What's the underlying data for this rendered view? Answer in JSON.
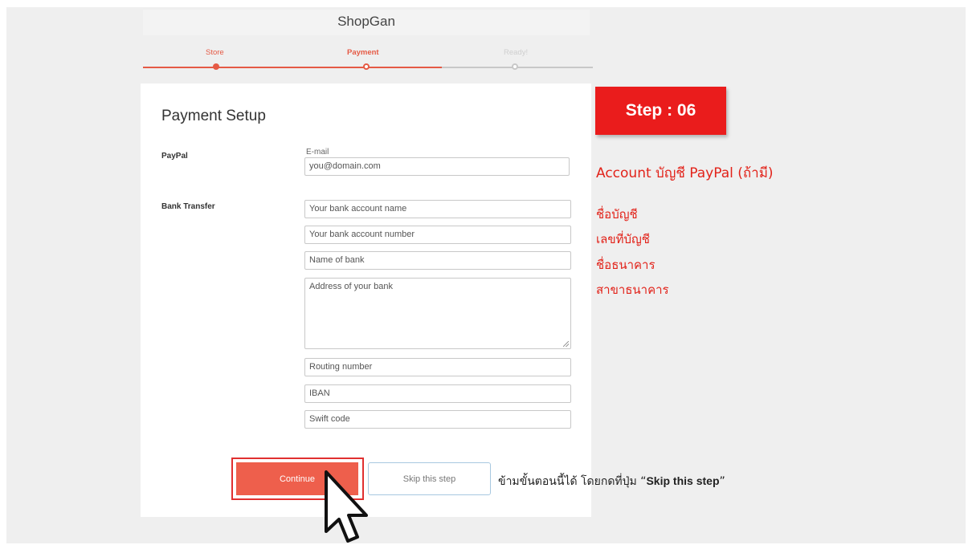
{
  "app": {
    "title": "ShopGan"
  },
  "steps": [
    {
      "label": "Store",
      "state": "done"
    },
    {
      "label": "Payment",
      "state": "active"
    },
    {
      "label": "Ready!",
      "state": "pending"
    }
  ],
  "form": {
    "title": "Payment Setup",
    "paypal": {
      "label": "PayPal",
      "email_label": "E-mail",
      "email_placeholder": "you@domain.com"
    },
    "bank": {
      "label": "Bank Transfer",
      "account_name_placeholder": "Your bank account name",
      "account_number_placeholder": "Your bank account number",
      "bank_name_placeholder": "Name of bank",
      "address_placeholder": "Address of your bank",
      "routing_placeholder": "Routing number",
      "iban_placeholder": "IBAN",
      "swift_placeholder": "Swift code"
    },
    "continue_label": "Continue",
    "skip_label": "Skip this step"
  },
  "annotations": {
    "step_badge": "Step : 06",
    "paypal_note": "Account บัญชี PayPal (ถ้ามี)",
    "bank_notes": [
      "ชื่อบัญชี",
      "เลขที่บัญชี",
      "ชื่อธนาคาร",
      "สาขาธนาคาร"
    ],
    "skip_note_prefix": "ข้ามขั้นตอนนี้ได้ โดยกดที่ปุ่ม “",
    "skip_note_bold": "Skip this step",
    "skip_note_suffix": "”"
  },
  "colors": {
    "accent": "#ee5f4c",
    "progress_active": "#e55a45",
    "progress_pending": "#c8c8c8",
    "annotation_red": "#e2231a"
  },
  "icons": {
    "cursor": "mouse-pointer-icon"
  }
}
